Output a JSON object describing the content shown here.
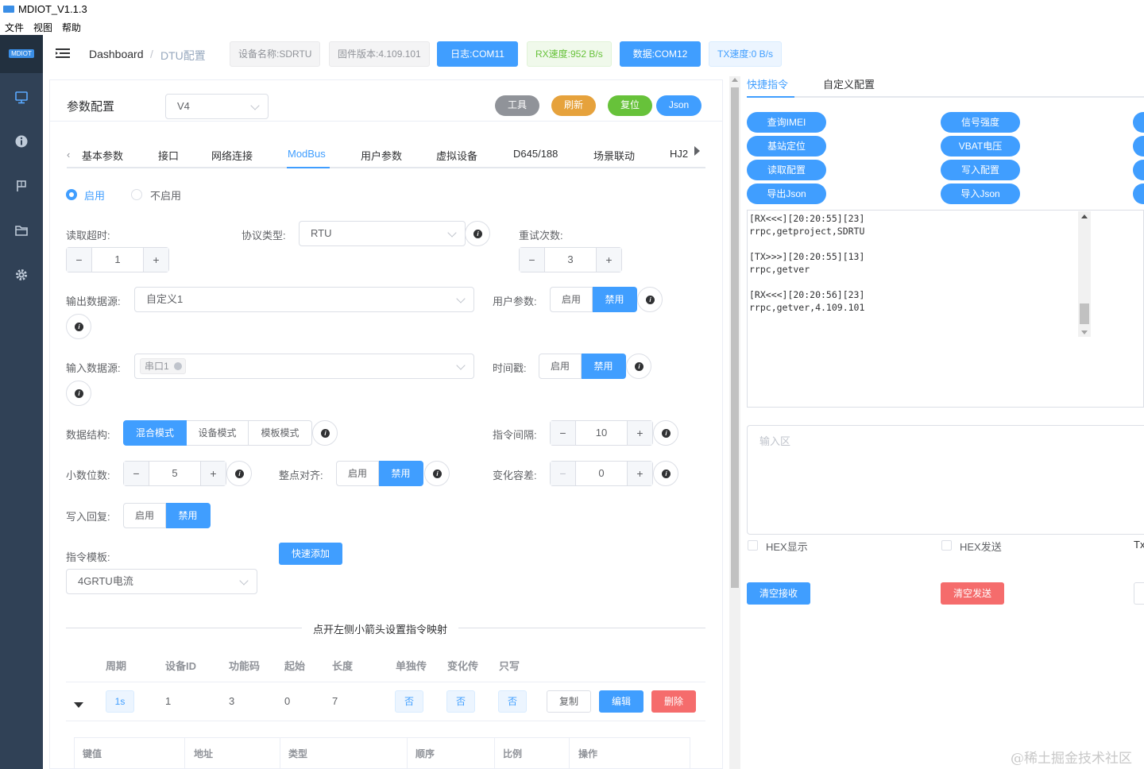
{
  "window": {
    "title": "MDIOT_V1.1.3",
    "logo_text": "MDIOT"
  },
  "menu": [
    "文件",
    "视图",
    "帮助"
  ],
  "breadcrumb": {
    "home": "Dashboard",
    "sep": "/",
    "current": "DTU配置"
  },
  "status_tags": {
    "device_name": "设备名称:SDRTU",
    "firmware": "固件版本:4.109.101",
    "log_port": "日志:COM11",
    "rx_speed": "RX速度:952 B/s",
    "data_port": "数据:COM12",
    "tx_speed": "TX速度:0 B/s"
  },
  "config": {
    "title": "参数配置",
    "version_select": "V4",
    "buttons": {
      "tool": "工具",
      "refresh": "刷新",
      "reset": "复位",
      "json": "Json"
    },
    "tabs": [
      "基本参数",
      "接口",
      "网络连接",
      "ModBus",
      "用户参数",
      "虚拟设备",
      "D645/188",
      "场景联动",
      "HJ2"
    ],
    "active_tab": "ModBus",
    "enable_radio": {
      "on": "启用",
      "off": "不启用",
      "selected": "启用"
    },
    "read_timeout": {
      "label": "读取超时:",
      "value": "1"
    },
    "protocol": {
      "label": "协议类型:",
      "value": "RTU"
    },
    "retry": {
      "label": "重试次数:",
      "value": "3"
    },
    "output_source": {
      "label": "输出数据源:",
      "value": "自定义1"
    },
    "user_param": {
      "label": "用户参数:",
      "enable": "启用",
      "disable": "禁用",
      "selected": "禁用"
    },
    "input_source": {
      "label": "输入数据源:",
      "chip": "串口1"
    },
    "timestamp": {
      "label": "时间戳:",
      "enable": "启用",
      "disable": "禁用",
      "selected": "禁用"
    },
    "data_struct": {
      "label": "数据结构:",
      "options": [
        "混合模式",
        "设备模式",
        "模板模式"
      ],
      "selected": "混合模式"
    },
    "cmd_interval": {
      "label": "指令间隔:",
      "value": "10"
    },
    "decimals": {
      "label": "小数位数:",
      "value": "5"
    },
    "align": {
      "label": "整点对齐:",
      "enable": "启用",
      "disable": "禁用",
      "selected": "禁用"
    },
    "tolerance": {
      "label": "变化容差:",
      "value": "0"
    },
    "write_reply": {
      "label": "写入回复:",
      "enable": "启用",
      "disable": "禁用",
      "selected": "禁用"
    },
    "template": {
      "label": "指令模板:",
      "value": "4GRTU电流",
      "quick_add": "快速添加"
    },
    "divider_text": "点开左侧小箭头设置指令映射",
    "table": {
      "headers": [
        "周期",
        "设备ID",
        "功能码",
        "起始",
        "长度",
        "单独传",
        "变化传",
        "只写"
      ],
      "row": {
        "period": "1s",
        "device_id": "1",
        "func": "3",
        "start": "0",
        "length": "7",
        "single": "否",
        "change": "否",
        "write_only": "否"
      },
      "actions": {
        "copy": "复制",
        "edit": "编辑",
        "delete": "删除"
      },
      "sub_headers": [
        "键值",
        "地址",
        "类型",
        "顺序",
        "比例",
        "操作"
      ]
    }
  },
  "right": {
    "tabs": [
      "快捷指令",
      "自定义配置"
    ],
    "active_tab": "快捷指令",
    "quick": [
      "查询IMEI",
      "信号强度",
      "基站定位",
      "VBAT电压",
      "读取配置",
      "写入配置",
      "导出Json",
      "导入Json"
    ],
    "log_lines": [
      "[RX<<<][20:20:55][23]",
      "rrpc,getproject,SDRTU",
      "",
      "[TX>>>][20:20:55][13]",
      "rrpc,getver",
      "",
      "[RX<<<][20:20:56][23]",
      "rrpc,getver,4.109.101"
    ],
    "input_placeholder": "输入区",
    "hex_show": "HEX显示",
    "hex_send": "HEX发送",
    "tx_partial": "Tx",
    "clear_recv": "清空接收",
    "clear_send": "清空发送"
  },
  "watermark": "@稀土掘金技术社区",
  "colors": {
    "primary": "#409eff",
    "sidebar": "#304156",
    "warning": "#e6a23c",
    "success": "#67c23a",
    "danger": "#f56c6c",
    "info": "#909399"
  }
}
